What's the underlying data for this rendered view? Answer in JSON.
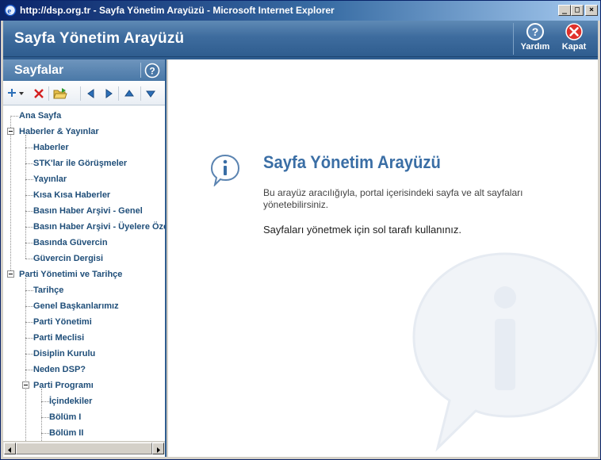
{
  "window": {
    "title": "http://dsp.org.tr - Sayfa Yönetim Arayüzü - Microsoft Internet Explorer",
    "controls": [
      "_",
      "□",
      "×"
    ]
  },
  "header": {
    "title": "Sayfa Yönetim Arayüzü",
    "help_label": "Yardım",
    "close_label": "Kapat"
  },
  "panel": {
    "title": "Sayfalar",
    "help_icon": "?"
  },
  "toolbar": {
    "icons": [
      "add-icon",
      "delete-icon",
      "open-folder-icon",
      "move-left-icon",
      "move-right-icon",
      "move-up-icon",
      "move-down-icon"
    ]
  },
  "tree": {
    "items": [
      {
        "label": "Ana Sayfa"
      },
      {
        "label": "Haberler & Yayınlar"
      },
      {
        "label": "Haberler"
      },
      {
        "label": "STK'lar ile Görüşmeler"
      },
      {
        "label": "Yayınlar"
      },
      {
        "label": "Kısa Kısa Haberler"
      },
      {
        "label": "Basın Haber Arşivi - Genel"
      },
      {
        "label": "Basın Haber Arşivi - Üyelere Özel"
      },
      {
        "label": "Basında Güvercin"
      },
      {
        "label": "Güvercin Dergisi"
      },
      {
        "label": "Parti Yönetimi ve Tarihçe"
      },
      {
        "label": "Tarihçe"
      },
      {
        "label": "Genel Başkanlarımız"
      },
      {
        "label": "Parti Yönetimi"
      },
      {
        "label": "Parti Meclisi"
      },
      {
        "label": "Disiplin Kurulu"
      },
      {
        "label": "Neden DSP?"
      },
      {
        "label": "Parti Programı"
      },
      {
        "label": "İçindekiler"
      },
      {
        "label": "Bölüm I"
      },
      {
        "label": "Bölüm II"
      }
    ]
  },
  "content": {
    "title": "Sayfa Yönetim Arayüzü",
    "description": "Bu arayüz aracılığıyla, portal içerisindeki sayfa ve alt sayfaları yönetebilirsiniz.",
    "hint": "Sayfaları yönetmek için sol tarafı kullanınız."
  },
  "colors": {
    "header_blue": "#3e6c9e",
    "title_blue": "#3a6ea5",
    "tree_text": "#1f4e79"
  }
}
